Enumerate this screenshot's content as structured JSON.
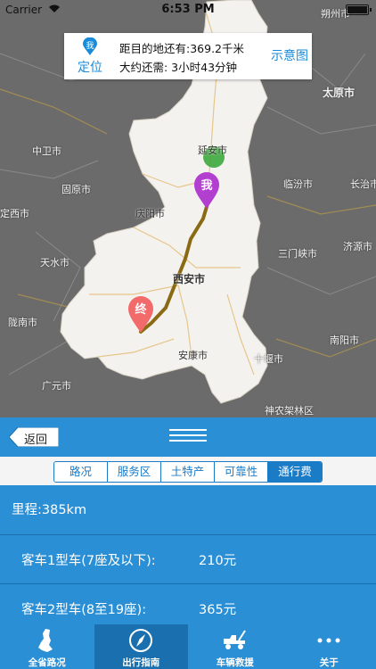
{
  "status_bar": {
    "carrier": "Carrier",
    "time": "6:53 PM"
  },
  "map": {
    "labels": {
      "shuozhou": "朔州市",
      "taiyuan": "太原市",
      "zhongwei": "中卫市",
      "yanan": "延安市",
      "linfen": "临汾市",
      "changzhi": "长治市",
      "guyuan": "固原市",
      "qingyang": "庆阳市",
      "dingxi": "定西市",
      "sanmenxia": "三门峡市",
      "jiyuan": "济源市",
      "tianshui": "天水市",
      "xian": "西安市",
      "nanyang": "南阳市",
      "longnan": "陇南市",
      "ankang": "安康市",
      "shiyan": "十堰市",
      "guangyuan": "广元市",
      "shennongjia": "神农架林区"
    },
    "start_marker": "我",
    "end_marker": "终",
    "colors": {
      "province": "#f4f2ee",
      "route": "#8a6a14",
      "start_marker": "#b33fd1",
      "end_marker": "#f26a6a"
    }
  },
  "info_card": {
    "locate_badge": "我",
    "locate_label": "定位",
    "distance_text": "距目的地还有:369.2千米",
    "time_text": "大约还需: 3小时43分钟",
    "diagram_label": "示意图"
  },
  "panel": {
    "back_label": "返回",
    "tabs": [
      {
        "label": "路况",
        "active": false
      },
      {
        "label": "服务区",
        "active": false
      },
      {
        "label": "土特产",
        "active": false
      },
      {
        "label": "可靠性",
        "active": false
      },
      {
        "label": "通行费",
        "active": true
      }
    ],
    "mileage": "里程:385km",
    "fees": [
      {
        "label": "客车1型车(7座及以下):",
        "value": "210元"
      },
      {
        "label": "客车2型车(8至19座):",
        "value": "365元"
      }
    ]
  },
  "tab_bar": {
    "items": [
      {
        "label": "全省路况",
        "icon": "province-map-icon",
        "selected": false
      },
      {
        "label": "出行指南",
        "icon": "compass-icon",
        "selected": true
      },
      {
        "label": "车辆救援",
        "icon": "tow-truck-icon",
        "selected": false
      },
      {
        "label": "关于",
        "icon": "more-dots-icon",
        "selected": false
      }
    ],
    "colors": {
      "bar": "#2b8fd6",
      "selected": "#1a6fae"
    }
  }
}
